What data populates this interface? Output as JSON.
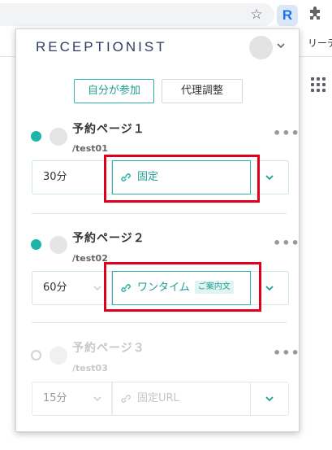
{
  "browser": {
    "extension_label": "R",
    "bookmark_item": "リーディ"
  },
  "popup": {
    "logo": {
      "part1": "RECEPTIONIST",
      "part2": ""
    },
    "tabs": [
      {
        "label": "自分が参加",
        "active": true
      },
      {
        "label": "代理調整",
        "active": false
      }
    ],
    "pages": [
      {
        "title": "予約ページ１",
        "slug": "/test01",
        "enabled": true,
        "duration": "30分",
        "link_type": "固定",
        "badge": "",
        "more": "•••"
      },
      {
        "title": "予約ページ２",
        "slug": "/test02",
        "enabled": true,
        "duration": "60分",
        "link_type": "ワンタイム",
        "badge": "ご案内文",
        "more": "•••"
      },
      {
        "title": "予約ページ３",
        "slug": "/test03",
        "enabled": false,
        "duration": "15分",
        "link_type": "固定URL",
        "badge": "",
        "more": "•••"
      }
    ]
  },
  "colors": {
    "accent": "#2bb3a7",
    "highlight": "#e0001b"
  }
}
